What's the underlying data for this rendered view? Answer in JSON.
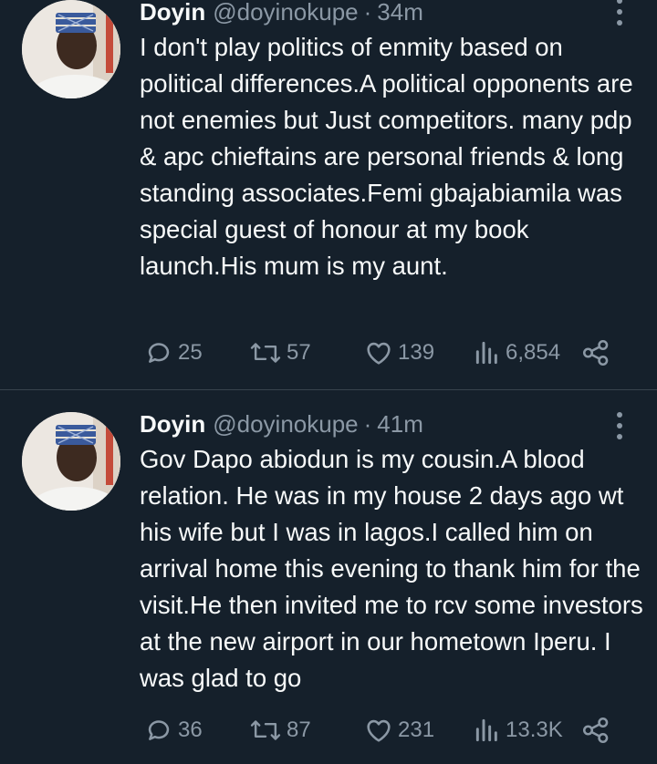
{
  "tweets": [
    {
      "name": "Doyin",
      "handle": "@doyinokupe",
      "separator": "·",
      "time": "34m",
      "text": "I don't play politics of enmity based on political differences.A political opponents are not enemies but Just competitors. many pdp & apc chieftains are personal friends & long standing associates.Femi gbajabiamila was special guest of honour at my book launch.His mum is my aunt.",
      "replies": "25",
      "retweets": "57",
      "likes": "139",
      "views": "6,854"
    },
    {
      "name": "Doyin",
      "handle": "@doyinokupe",
      "separator": "·",
      "time": "41m",
      "text": "Gov Dapo abiodun is my cousin.A blood relation. He was in my house 2 days ago wt his wife but I was in lagos.I called him on arrival home this evening to thank him for the visit.He then invited me to rcv some investors at the new airport in our hometown Iperu. I was glad to go",
      "replies": "36",
      "retweets": "87",
      "likes": "231",
      "views": "13.3K"
    }
  ],
  "icons": {
    "reply": "reply-icon",
    "retweet": "retweet-icon",
    "like": "heart-icon",
    "views": "views-icon",
    "share": "share-icon",
    "more": "more-vertical-icon"
  },
  "colors": {
    "background": "#15202b",
    "primary_text": "#f7f9f9",
    "secondary_text": "#8b98a5",
    "divider": "#38444d"
  }
}
